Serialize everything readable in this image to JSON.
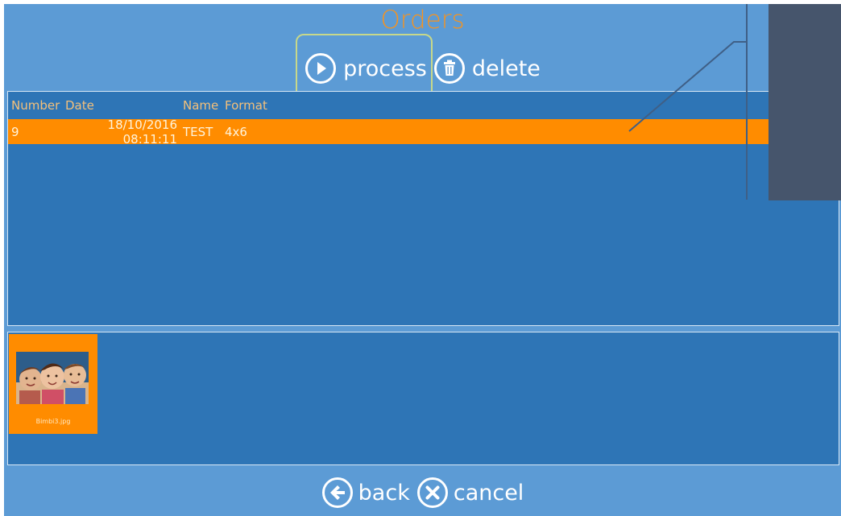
{
  "app": {
    "title": "Orders"
  },
  "toolbar": {
    "process_label": "process",
    "delete_label": "delete",
    "process_icon": "play-icon",
    "delete_icon": "trash-icon"
  },
  "orders_table": {
    "columns": [
      "Number",
      "Date",
      "Name",
      "Format"
    ],
    "rows": [
      {
        "number": "9",
        "date": "18/10/2016 08:11:11",
        "name": "TEST",
        "format": "4x6"
      }
    ]
  },
  "thumbnails": [
    {
      "filename": "Bimbi3.jpg"
    }
  ],
  "footer": {
    "back_label": "back",
    "cancel_label": "cancel",
    "back_icon": "arrow-left-icon",
    "cancel_icon": "close-icon"
  },
  "colors": {
    "background": "#5c9bd5",
    "panel": "#2e75b6",
    "accent": "#ff8c00",
    "title": "#f7931e",
    "overlay": "#46556c"
  }
}
